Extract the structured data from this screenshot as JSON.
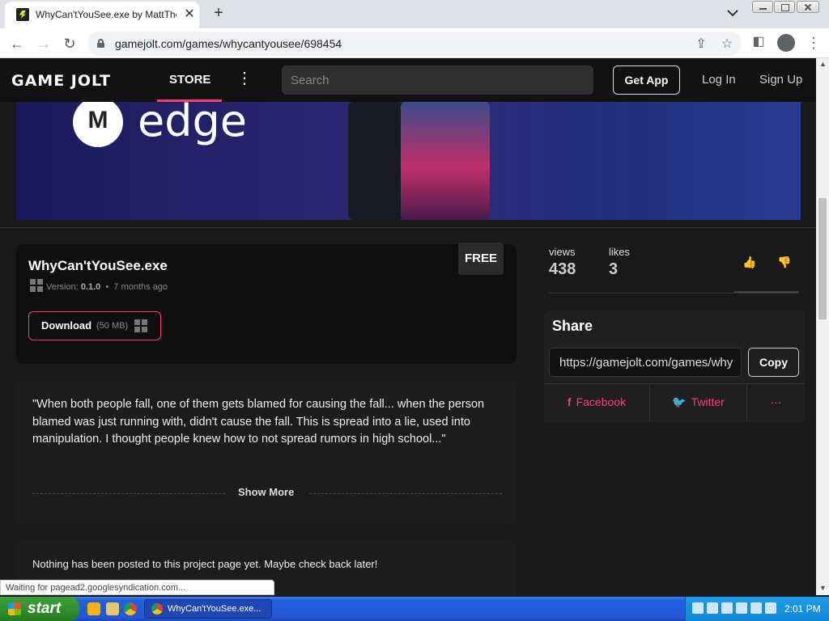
{
  "browser": {
    "tab_title": "WhyCan'tYouSee.exe by MattTheGa",
    "url": "gamejolt.com/games/whycantyousee/698454"
  },
  "nav": {
    "logo": "GAME JOLT",
    "store": "STORE",
    "search_placeholder": "Search",
    "get_app": "Get App",
    "log_in": "Log In",
    "sign_up": "Sign Up"
  },
  "banner": {
    "brand_text": "edge"
  },
  "game": {
    "title": "WhyCan'tYouSee.exe",
    "version_label": "Version:",
    "version": "0.1.0",
    "bullet": "•",
    "age": "7 months ago",
    "price_badge": "FREE",
    "download_label": "Download",
    "download_size": "(50 MB)"
  },
  "stats": {
    "views_label": "views",
    "views_value": "438",
    "likes_label": "likes",
    "likes_value": "3"
  },
  "share": {
    "title": "Share",
    "url_value": "https://gamejolt.com/games/why",
    "copy": "Copy",
    "facebook": "Facebook",
    "twitter": "Twitter",
    "more": "···"
  },
  "description": {
    "text": "\"When both people fall, one of them gets blamed for causing the fall... when the person blamed was just running with, didn't cause the fall. This is spread into a lie, used into manipulation. I thought people knew how to not spread rumors in high school...\"",
    "show_more": "Show More"
  },
  "posts": {
    "empty_text": "Nothing has been posted to this project page yet. Maybe check back later!"
  },
  "status_bar": "Waiting for pagead2.googlesyndication.com...",
  "taskbar": {
    "start": "start",
    "task_title": "WhyCan'tYouSee.exe...",
    "clock": "2:01 PM"
  },
  "colors": {
    "accent": "#ff3c6e",
    "nav_bg": "#111111",
    "page_bg": "#191919"
  }
}
